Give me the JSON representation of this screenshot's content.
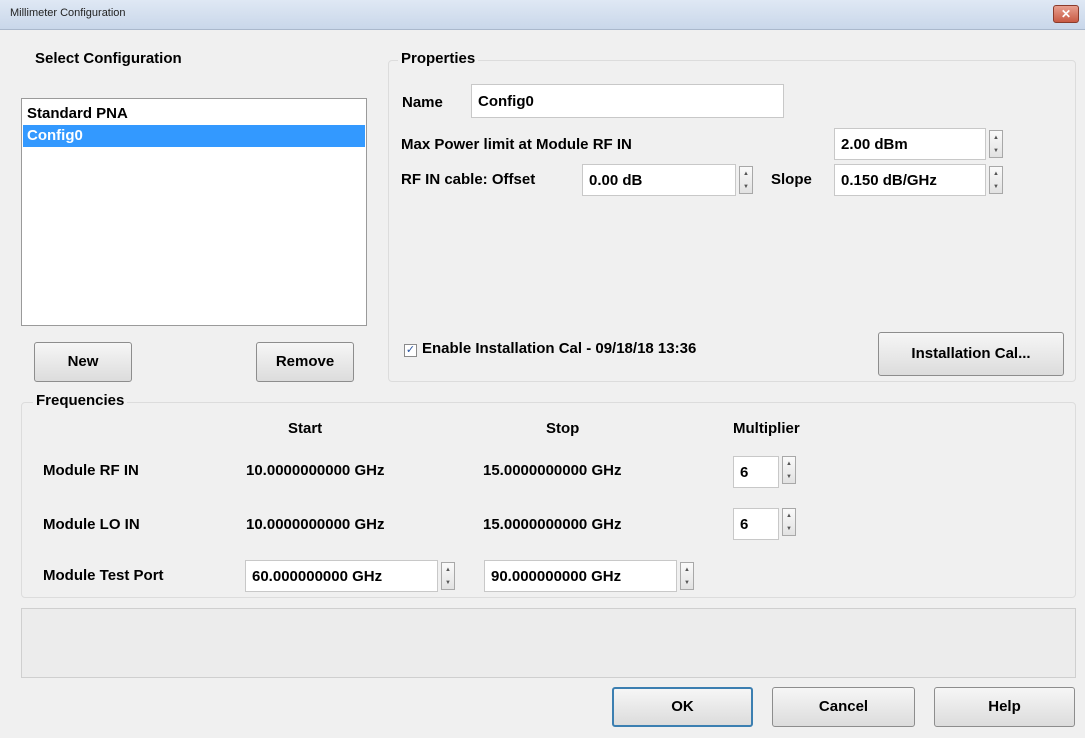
{
  "window": {
    "title": "Millimeter Configuration",
    "close_glyph": "✕"
  },
  "select_config": {
    "heading": "Select Configuration",
    "items": [
      {
        "label": "Standard PNA",
        "selected": false
      },
      {
        "label": "Config0",
        "selected": true
      }
    ],
    "new_label": "New",
    "remove_label": "Remove"
  },
  "properties": {
    "heading": "Properties",
    "name_label": "Name",
    "name_value": "Config0",
    "max_power_label": "Max Power limit at Module RF IN",
    "max_power_value": "2.00 dBm",
    "rf_cable_label": "RF IN cable: Offset",
    "offset_value": "0.00 dB",
    "slope_label": "Slope",
    "slope_value": "0.150 dB/GHz",
    "enable_cal_label": "Enable Installation Cal - 09/18/18 13:36",
    "enable_cal_checked": true,
    "install_cal_label": "Installation Cal..."
  },
  "frequencies": {
    "heading": "Frequencies",
    "col_start": "Start",
    "col_stop": "Stop",
    "col_multiplier": "Multiplier",
    "rows": [
      {
        "label": "Module RF IN",
        "start": "10.0000000000 GHz",
        "stop": "15.0000000000 GHz",
        "multiplier": "6"
      },
      {
        "label": "Module LO IN",
        "start": "10.0000000000 GHz",
        "stop": "15.0000000000 GHz",
        "multiplier": "6"
      },
      {
        "label": "Module Test Port",
        "start": "60.000000000 GHz",
        "stop": "90.000000000 GHz"
      }
    ]
  },
  "footer": {
    "ok_label": "OK",
    "cancel_label": "Cancel",
    "help_label": "Help"
  }
}
